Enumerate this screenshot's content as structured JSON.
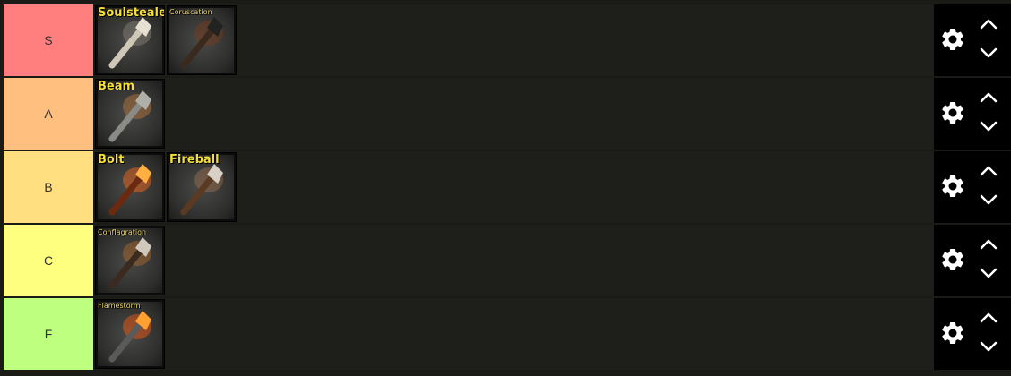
{
  "tiers": [
    {
      "label": "S",
      "color": "#ff7f7f",
      "items": [
        {
          "name": "Soulstealer",
          "style": "big",
          "art": "bone"
        },
        {
          "name": "Coruscation",
          "style": "small",
          "art": "dark"
        }
      ]
    },
    {
      "label": "A",
      "color": "#ffbf7f",
      "items": [
        {
          "name": "Beam",
          "style": "big",
          "art": "rod"
        }
      ]
    },
    {
      "label": "B",
      "color": "#ffdf7f",
      "items": [
        {
          "name": "Bolt",
          "style": "big",
          "art": "fire"
        },
        {
          "name": "Fireball",
          "style": "big",
          "art": "skull"
        }
      ]
    },
    {
      "label": "C",
      "color": "#ffff7f",
      "items": [
        {
          "name": "Conflagration",
          "style": "small",
          "art": "crown"
        }
      ]
    },
    {
      "label": "F",
      "color": "#bfff7f",
      "items": [
        {
          "name": "Flamestorm",
          "style": "small",
          "art": "flame"
        }
      ]
    }
  ],
  "icons": {
    "settings": "gear-icon",
    "move_up": "chevron-up-icon",
    "move_down": "chevron-down-icon"
  }
}
